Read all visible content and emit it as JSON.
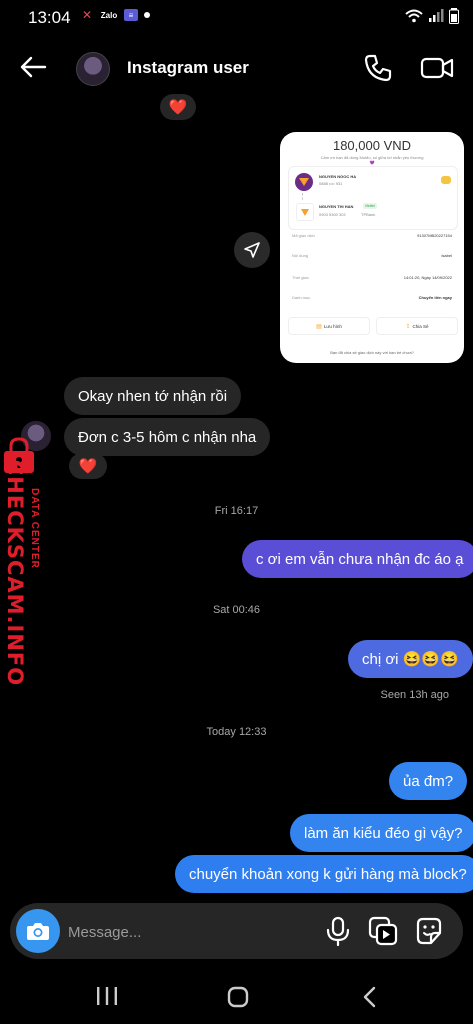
{
  "status_bar": {
    "time": "13:04",
    "app_badges": [
      "Zalo"
    ]
  },
  "header": {
    "title": "Instagram user"
  },
  "reactions": {
    "heart": "❤️"
  },
  "receipt": {
    "amount": "180,000 VND",
    "subtitle": "Cảm ơn bạn đã dùng MoMo, số giữa lời nhắn yêu thương 💜",
    "sender_name": "NGUYEN NGOC HA",
    "sender_phone": "0888 •••• 931",
    "receiver_name": "NGUYEN THI HAN",
    "receiver_tag": "Viettel",
    "receiver_phone": "0903 5300 302",
    "receiver_bank": "TPBank",
    "rows": [
      {
        "label": "Mã giao dịch",
        "value": "91307MB20227154"
      },
      {
        "label": "Nội dung",
        "value": "Isabel"
      },
      {
        "label": "Thời gian",
        "value": "14:01:20, Ngày 14/09/2022"
      },
      {
        "label": "Danh mục",
        "value": "Chuyển tiền ngay"
      }
    ],
    "save_label": "Lưu hình",
    "share_label": "Chia Sẻ",
    "footer": "Bạn đã chia sẻ giao dịch này với bạn bè chưa?"
  },
  "messages": {
    "in_1": "Okay nhen tớ nhận rồi",
    "in_2": "Đơn c 3-5 hôm c nhận nha",
    "ts_1": "Fri 16:17",
    "out_1": "c ơi em vẫn chưa nhận đc áo ạ",
    "ts_2": "Sat 00:46",
    "out_2": "chị ơi 😆😆😆",
    "seen": "Seen 13h ago",
    "ts_3": "Today 12:33",
    "out_3": "ủa đm?",
    "out_4": "làm ăn kiểu đéo gì vậy?",
    "out_5": "chuyển khoản xong k gửi hàng mà block?"
  },
  "watermark": {
    "brand": "CHECKSCAM.INFO",
    "tagline": "DATA CENTER"
  },
  "composer": {
    "placeholder": "Message..."
  },
  "colors": {
    "out_top": "#5a4ed6",
    "out_bottom": "#2f7ef0",
    "accent": "#3797f0",
    "watermark": "#e01e2b"
  }
}
